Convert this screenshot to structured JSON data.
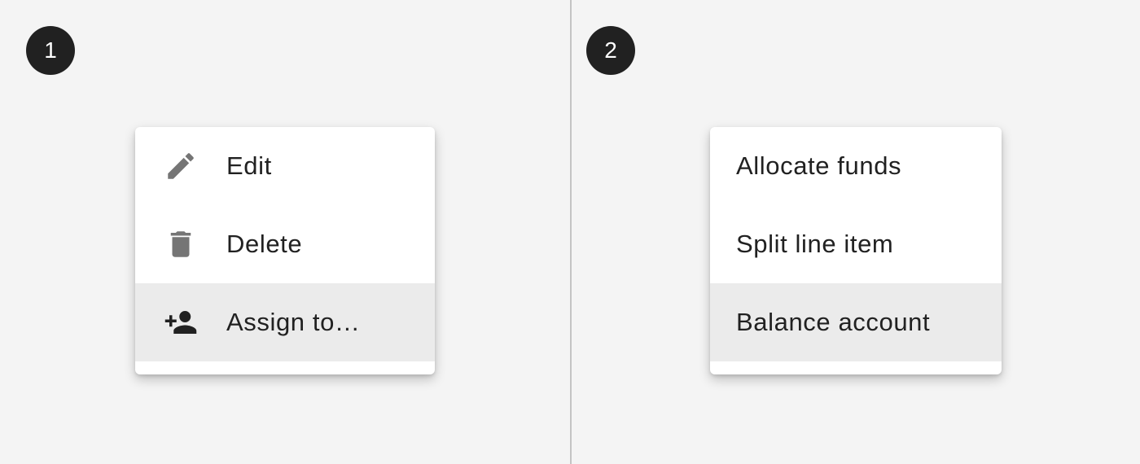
{
  "left_panel": {
    "step": "1",
    "menu": {
      "items": [
        {
          "label": "Edit",
          "icon": "pencil-icon",
          "highlighted": false
        },
        {
          "label": "Delete",
          "icon": "trash-icon",
          "highlighted": false
        },
        {
          "label": "Assign to…",
          "icon": "person-add-icon",
          "highlighted": true
        }
      ]
    }
  },
  "right_panel": {
    "step": "2",
    "menu": {
      "items": [
        {
          "label": "Allocate funds",
          "highlighted": false
        },
        {
          "label": "Split line item",
          "highlighted": false
        },
        {
          "label": "Balance account",
          "highlighted": true
        }
      ]
    }
  },
  "colors": {
    "background": "#f4f4f4",
    "badge": "#212121",
    "menu_surface": "#ffffff",
    "highlight": "#ebebeb",
    "icon_gray": "#757575",
    "icon_dark": "#212121",
    "text": "#212121"
  }
}
